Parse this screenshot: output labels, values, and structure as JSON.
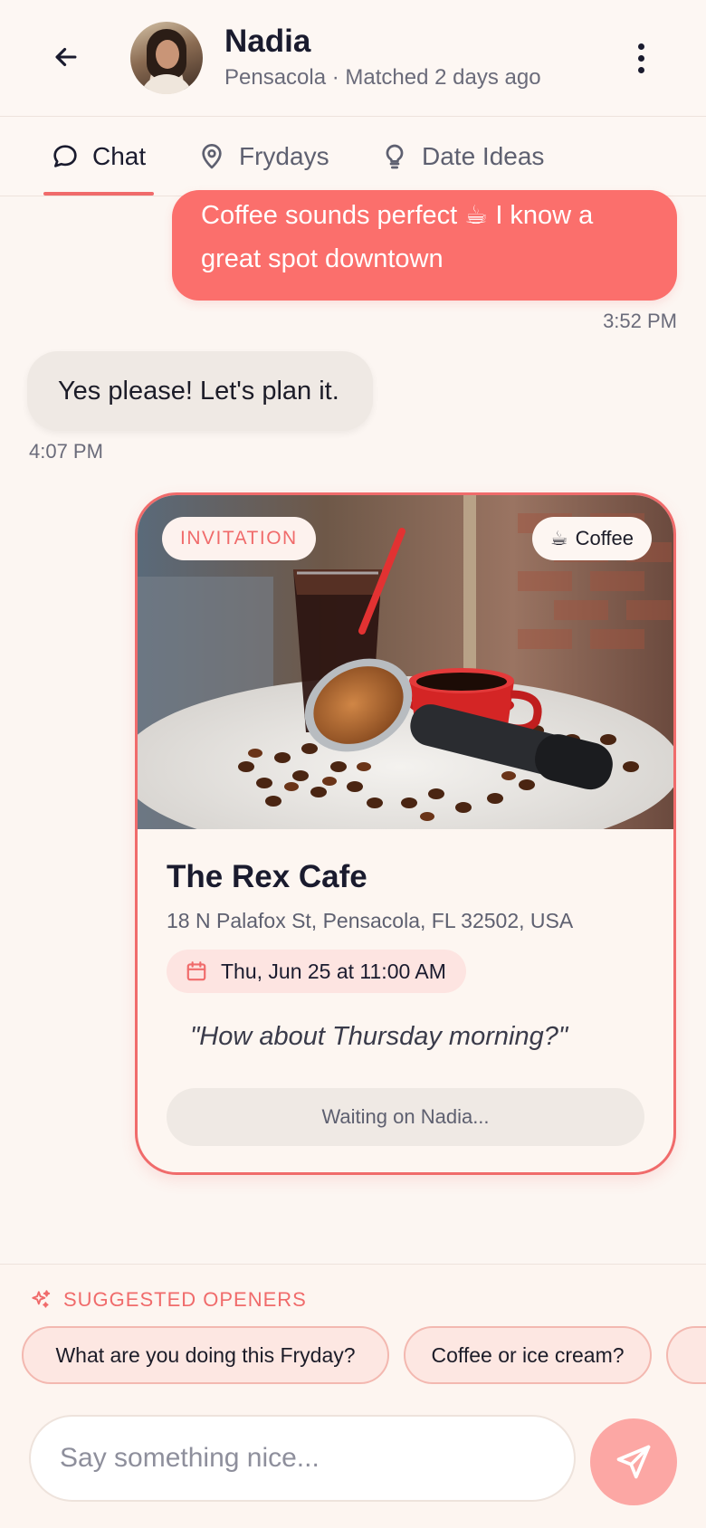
{
  "header": {
    "name": "Nadia",
    "subtitle": "Pensacola · Matched 2 days ago"
  },
  "tabs": [
    {
      "label": "Chat",
      "icon": "chat-bubble-icon",
      "active": true
    },
    {
      "label": "Frydays",
      "icon": "map-pin-icon",
      "active": false
    },
    {
      "label": "Date Ideas",
      "icon": "lightbulb-icon",
      "active": false
    }
  ],
  "messages": [
    {
      "from": "me",
      "text": "Coffee sounds perfect ☕ I know a great spot downtown",
      "time": "3:52 PM"
    },
    {
      "from": "them",
      "text": "Yes please! Let's plan it.",
      "time": "4:07 PM"
    }
  ],
  "invitation": {
    "badge": "INVITATION",
    "category": "Coffee",
    "category_icon": "☕",
    "venue": "The Rex Cafe",
    "address": "18 N Palafox St, Pensacola, FL 32502, USA",
    "datetime": "Thu, Jun 25 at 11:00 AM",
    "note": "\"How about Thursday morning?\"",
    "status": "Waiting on Nadia..."
  },
  "suggestions": {
    "title": "SUGGESTED OPENERS",
    "items": [
      "What are you doing this Fryday?",
      "Coffee or ice cream?",
      ""
    ]
  },
  "composer": {
    "placeholder": "Say something nice..."
  },
  "colors": {
    "accent": "#f06b6b",
    "bubble_out": "#fb6f6c",
    "bubble_in": "#efe9e4",
    "background": "#fcf6f2"
  }
}
